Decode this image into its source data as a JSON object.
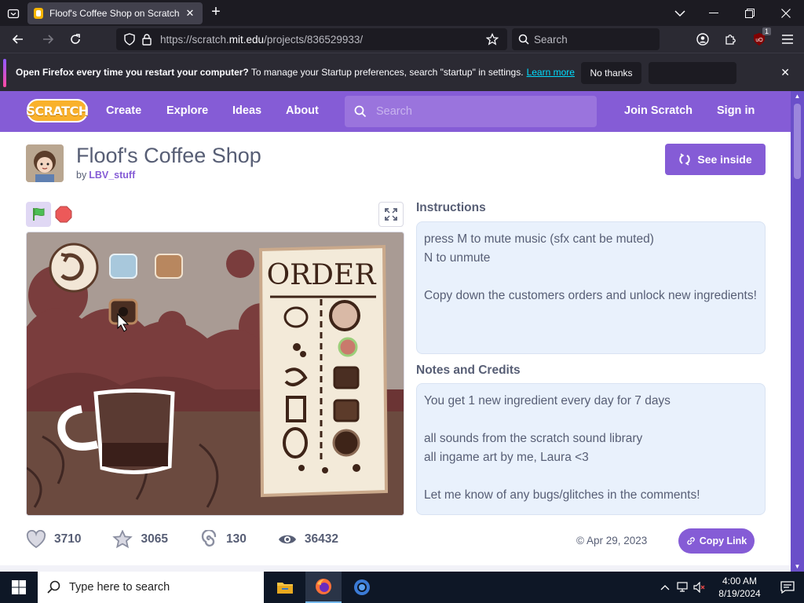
{
  "browser": {
    "tab_title": "Floof's Coffee Shop on Scratch",
    "url_prefix": "https://scratch.",
    "url_host": "mit.edu",
    "url_path": "/projects/836529933/",
    "search_placeholder": "Search",
    "extension_badge": "1"
  },
  "notification": {
    "bold": "Open Firefox every time you restart your computer?",
    "text": " To manage your Startup preferences, search \"startup\" in settings.",
    "link": "Learn more",
    "no_thanks": "No thanks"
  },
  "scratch_nav": {
    "logo": "SCRATCH",
    "create": "Create",
    "explore": "Explore",
    "ideas": "Ideas",
    "about": "About",
    "search_placeholder": "Search",
    "join": "Join Scratch",
    "signin": "Sign in"
  },
  "project": {
    "title": "Floof's Coffee Shop",
    "by": "by",
    "author": "LBV_stuff",
    "see_inside": "See inside",
    "instructions_title": "Instructions",
    "instructions": [
      "press M to mute music (sfx cant be muted)",
      "N to unmute",
      "",
      "Copy down the customers orders and unlock new ingredients!"
    ],
    "notes_title": "Notes and Credits",
    "notes": [
      "You get 1 new ingredient every day for 7 days",
      "",
      "all sounds from the scratch sound library",
      "all ingame art by me, Laura <3",
      "",
      "Let me know of any bugs/glitches in the comments!"
    ],
    "loves": "3710",
    "favorites": "3065",
    "remixes": "130",
    "views": "36432",
    "date": "© Apr 29, 2023",
    "copy_link": "Copy Link",
    "stage_order_text": "ORDER"
  },
  "taskbar": {
    "search_placeholder": "Type here to search",
    "time": "4:00 AM",
    "date": "8/19/2024"
  },
  "colors": {
    "scratch_purple": "#855cd6",
    "firefox_dark": "#1c1b22",
    "box_bg": "#e9f1fc"
  }
}
